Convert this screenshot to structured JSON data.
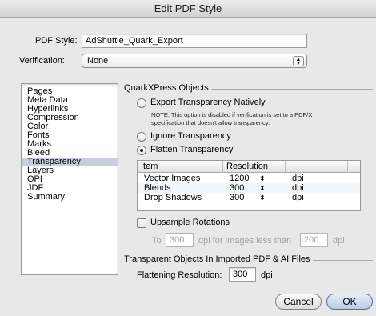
{
  "window": {
    "title": "Edit PDF Style"
  },
  "pdf_style": {
    "label": "PDF Style:",
    "value": "AdShuttle_Quark_Export"
  },
  "verification": {
    "label": "Verification:",
    "value": "None"
  },
  "sidebar": {
    "items": [
      {
        "label": "Pages"
      },
      {
        "label": "Meta Data"
      },
      {
        "label": "Hyperlinks"
      },
      {
        "label": "Compression"
      },
      {
        "label": "Color"
      },
      {
        "label": "Fonts"
      },
      {
        "label": "Marks"
      },
      {
        "label": "Bleed"
      },
      {
        "label": "Transparency",
        "selected": true
      },
      {
        "label": "Layers"
      },
      {
        "label": "OPI"
      },
      {
        "label": "JDF"
      },
      {
        "label": "Summary"
      }
    ]
  },
  "quark_objects": {
    "title": "QuarkXPress Objects",
    "export_natively": "Export Transparency Natively",
    "note_line1": "NOTE: This option is disabled if verification is set to a PDF/X",
    "note_line2": "specification that doesn't allow transparency.",
    "ignore": "Ignore Transparency",
    "flatten": "Flatten Transparency",
    "selected_option": "Flatten Transparency"
  },
  "table": {
    "columns": [
      "Item",
      "Resolution"
    ],
    "rows": [
      {
        "item": "Vector Images",
        "resolution": "1200",
        "unit": "dpi"
      },
      {
        "item": "Blends",
        "resolution": "300",
        "unit": "dpi"
      },
      {
        "item": "Drop Shadows",
        "resolution": "300",
        "unit": "dpi"
      }
    ]
  },
  "upsample": {
    "label": "Upsample Rotations",
    "checked": false,
    "to_label": "To",
    "to_value": "300",
    "mid_text": "dpi for images less than",
    "less_than_value": "200",
    "unit": "dpi"
  },
  "imported": {
    "title": "Transparent Objects In Imported PDF & AI Files",
    "flattening_label": "Flattening Resolution:",
    "flattening_value": "300",
    "unit": "dpi"
  },
  "buttons": {
    "cancel": "Cancel",
    "ok": "OK"
  }
}
